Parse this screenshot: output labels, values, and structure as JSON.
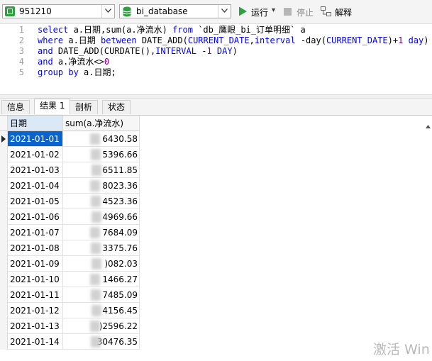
{
  "toolbar": {
    "connection": "951210",
    "database": "bi_database",
    "run_label": "运行",
    "run_dropdown": "▾",
    "stop_label": "停止",
    "explain_label": "解释"
  },
  "editor": {
    "line_numbers": [
      "1",
      "2",
      "3",
      "4",
      "5"
    ]
  },
  "tabs": [
    {
      "label": "信息"
    },
    {
      "label": "结果 1"
    },
    {
      "label": "剖析"
    },
    {
      "label": "状态"
    }
  ],
  "grid": {
    "columns": [
      "日期",
      "sum(a.净流水)"
    ],
    "rows": [
      {
        "date": "2021-01-01",
        "value": "6430.58"
      },
      {
        "date": "2021-01-02",
        "value": "5396.66"
      },
      {
        "date": "2021-01-03",
        "value": "6511.85"
      },
      {
        "date": "2021-01-04",
        "value": "8023.36"
      },
      {
        "date": "2021-01-05",
        "value": "4523.36"
      },
      {
        "date": "2021-01-06",
        "value": "4969.66"
      },
      {
        "date": "2021-01-07",
        "value": "7684.09"
      },
      {
        "date": "2021-01-08",
        "value": "3375.76"
      },
      {
        "date": "2021-01-09",
        "value": ")082.03"
      },
      {
        "date": "2021-01-10",
        "value": "1466.27"
      },
      {
        "date": "2021-01-11",
        "value": "7485.09"
      },
      {
        "date": "2021-01-12",
        "value": "4156.45"
      },
      {
        "date": "2021-01-13",
        "value": ")2596.22"
      },
      {
        "date": "2021-01-14",
        "value": "30476.35"
      }
    ]
  },
  "watermark": "激活 Win",
  "colors": {
    "selected_cell": "#0a64d0",
    "keyword": "#0000ff",
    "run_icon": "#2ea043"
  }
}
